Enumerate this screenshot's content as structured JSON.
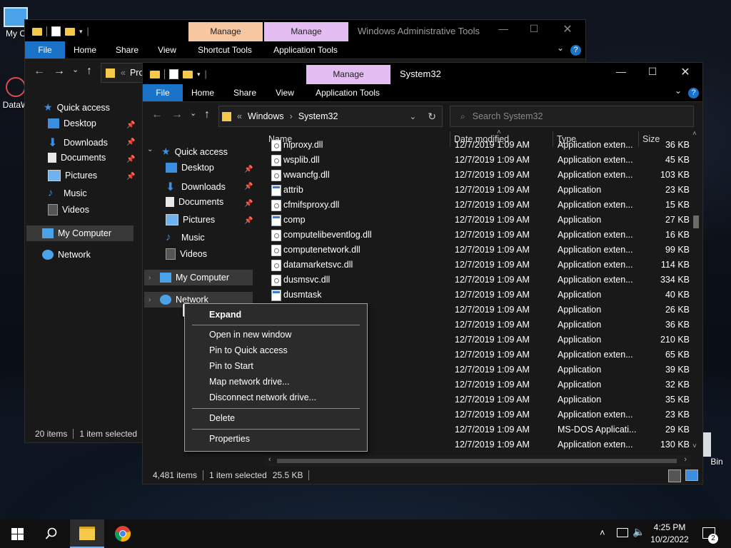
{
  "desktop": {
    "icons": [
      {
        "label": "My C"
      },
      {
        "label": "DataW"
      },
      {
        "label": "Bin"
      }
    ]
  },
  "back_window": {
    "qat_sep": "|",
    "manage_tab_1": "Manage",
    "manage_tab_2": "Manage",
    "title": "Windows Administrative Tools",
    "ribbon_tabs": [
      "File",
      "Home",
      "Share",
      "View",
      "Shortcut Tools",
      "Application Tools"
    ],
    "address_partial": "Pro",
    "nav": [
      "Quick access",
      "Desktop",
      "Downloads",
      "Documents",
      "Pictures",
      "Music",
      "Videos",
      "My Computer",
      "Network"
    ],
    "status_count": "20 items",
    "status_selected": "1 item selected"
  },
  "front_window": {
    "manage_tab": "Manage",
    "title": "System32",
    "ribbon_tabs": [
      "File",
      "Home",
      "Share",
      "View",
      "Application Tools"
    ],
    "address": {
      "chevrons": "«",
      "crumb1": "Windows",
      "arrow": "›",
      "crumb2": "System32"
    },
    "search_placeholder": "Search System32",
    "nav": [
      "Quick access",
      "Desktop",
      "Downloads",
      "Documents",
      "Pictures",
      "Music",
      "Videos",
      "My Computer",
      "Network"
    ],
    "columns": [
      "Name",
      "Date modified",
      "Type",
      "Size"
    ],
    "files": [
      {
        "name": "nlproxy.dll",
        "date": "12/7/2019 1:09 AM",
        "type": "Application exten...",
        "size": "36 KB",
        "kind": "dll"
      },
      {
        "name": "wsplib.dll",
        "date": "12/7/2019 1:09 AM",
        "type": "Application exten...",
        "size": "45 KB",
        "kind": "dll"
      },
      {
        "name": "wwancfg.dll",
        "date": "12/7/2019 1:09 AM",
        "type": "Application exten...",
        "size": "103 KB",
        "kind": "dll"
      },
      {
        "name": "attrib",
        "date": "12/7/2019 1:09 AM",
        "type": "Application",
        "size": "23 KB",
        "kind": "exe"
      },
      {
        "name": "cfmifsproxy.dll",
        "date": "12/7/2019 1:09 AM",
        "type": "Application exten...",
        "size": "15 KB",
        "kind": "dll"
      },
      {
        "name": "comp",
        "date": "12/7/2019 1:09 AM",
        "type": "Application",
        "size": "27 KB",
        "kind": "exe"
      },
      {
        "name": "computelibeventlog.dll",
        "date": "12/7/2019 1:09 AM",
        "type": "Application exten...",
        "size": "16 KB",
        "kind": "dll"
      },
      {
        "name": "computenetwork.dll",
        "date": "12/7/2019 1:09 AM",
        "type": "Application exten...",
        "size": "99 KB",
        "kind": "dll"
      },
      {
        "name": "datamarketsvc.dll",
        "date": "12/7/2019 1:09 AM",
        "type": "Application exten...",
        "size": "114 KB",
        "kind": "dll"
      },
      {
        "name": "dusmsvc.dll",
        "date": "12/7/2019 1:09 AM",
        "type": "Application exten...",
        "size": "334 KB",
        "kind": "dll"
      },
      {
        "name": "dusmtask",
        "date": "12/7/2019 1:09 AM",
        "type": "Application",
        "size": "40 KB",
        "kind": "exe"
      },
      {
        "name": "",
        "date": "12/7/2019 1:09 AM",
        "type": "Application",
        "size": "26 KB",
        "kind": "exe"
      },
      {
        "name": "",
        "date": "12/7/2019 1:09 AM",
        "type": "Application",
        "size": "36 KB",
        "kind": "exe"
      },
      {
        "name": "",
        "date": "12/7/2019 1:09 AM",
        "type": "Application",
        "size": "210 KB",
        "kind": "exe"
      },
      {
        "name": "",
        "date": "12/7/2019 1:09 AM",
        "type": "Application exten...",
        "size": "65 KB",
        "kind": "dll"
      },
      {
        "name": "",
        "date": "12/7/2019 1:09 AM",
        "type": "Application",
        "size": "39 KB",
        "kind": "exe"
      },
      {
        "name": "",
        "date": "12/7/2019 1:09 AM",
        "type": "Application",
        "size": "32 KB",
        "kind": "exe"
      },
      {
        "name": "",
        "date": "12/7/2019 1:09 AM",
        "type": "Application",
        "size": "35 KB",
        "kind": "exe"
      },
      {
        "name": "",
        "date": "12/7/2019 1:09 AM",
        "type": "Application exten...",
        "size": "23 KB",
        "kind": "dll"
      },
      {
        "name": "",
        "date": "12/7/2019 1:09 AM",
        "type": "MS-DOS Applicati...",
        "size": "29 KB",
        "kind": "exe"
      },
      {
        "name": "",
        "date": "12/7/2019 1:09 AM",
        "type": "Application exten...",
        "size": "130 KB",
        "kind": "dll"
      }
    ],
    "status_count": "4,481 items",
    "status_selected": "1 item selected",
    "status_size": "25.5 KB"
  },
  "context_menu": {
    "items": [
      "Expand",
      "Open in new window",
      "Pin to Quick access",
      "Pin to Start",
      "Map network drive...",
      "Disconnect network drive...",
      "Delete",
      "Properties"
    ]
  },
  "taskbar": {
    "time": "4:25 PM",
    "date": "10/2/2022",
    "notification_count": "2"
  },
  "colors": {
    "accent": "#1a73c8",
    "manage_tab_orange": "#f7c7a1",
    "manage_tab_purple": "#e4bdf3",
    "pane_bg": "#191919",
    "title_bg": "#000000"
  }
}
